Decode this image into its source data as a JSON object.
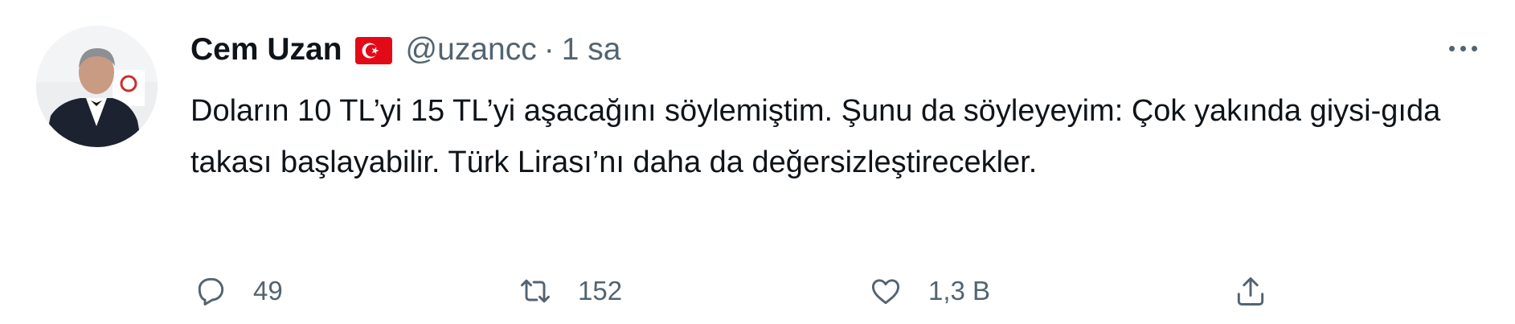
{
  "tweet": {
    "author": {
      "display_name": "Cem Uzan",
      "flag_icon": "turkey-flag-icon",
      "handle": "@uzancc",
      "separator": "·",
      "time": "1 sa"
    },
    "text": "Doların 10 TL’yi 15 TL’yi aşacağını söylemiştim. Şunu da söyleyeyim: Çok yakında giysi-gıda takası başlayabilir. Türk Lirası’nı daha da değersizleştirecekler.",
    "actions": {
      "reply": {
        "icon": "reply-icon",
        "count": "49"
      },
      "retweet": {
        "icon": "retweet-icon",
        "count": "152"
      },
      "like": {
        "icon": "like-icon",
        "count": "1,3 B"
      },
      "share": {
        "icon": "share-icon"
      }
    }
  },
  "colors": {
    "text_primary": "#0f1419",
    "text_secondary": "#536471",
    "flag_red": "#e30a17",
    "background": "#ffffff"
  }
}
